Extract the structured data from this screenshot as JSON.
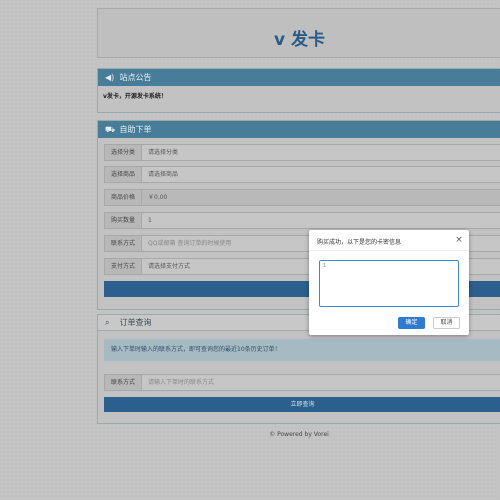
{
  "site": {
    "title": "v 发卡"
  },
  "notice": {
    "heading": "站点公告",
    "body": "v发卡，开源发卡系统！"
  },
  "order": {
    "heading": "自助下单",
    "rows": [
      {
        "label": "选择分类",
        "value": "请选择分类"
      },
      {
        "label": "选择商品",
        "value": "请选择商品"
      },
      {
        "label": "商品价格",
        "value": "￥0.00"
      },
      {
        "label": "购买数量",
        "value": "1"
      },
      {
        "label": "联系方式",
        "value": "QQ或邮箱 查询订单的时候使用"
      },
      {
        "label": "支付方式",
        "value": "请选择支付方式"
      }
    ]
  },
  "query": {
    "heading": "订单查询",
    "tip": "输入下单时输入的联系方式，即可查询您的最近10条历史订单！",
    "contact_label": "联系方式",
    "contact_placeholder": "请输入下单时的联系方式",
    "button": "立即查询"
  },
  "footer": {
    "text": "© Powered by Vorei"
  },
  "modal": {
    "title": "购买成功，以下是您的卡密信息",
    "close_glyph": "×",
    "textarea_value": "1",
    "ok_label": "确定",
    "cancel_label": "取消"
  },
  "icons": {
    "notice": "speaker-icon",
    "order": "cart-icon",
    "query": "search-icon",
    "close": "close-icon"
  },
  "colors": {
    "accent": "#2a5f8e",
    "panel_header": "#477d99",
    "primary_button": "#2e7ad1"
  }
}
